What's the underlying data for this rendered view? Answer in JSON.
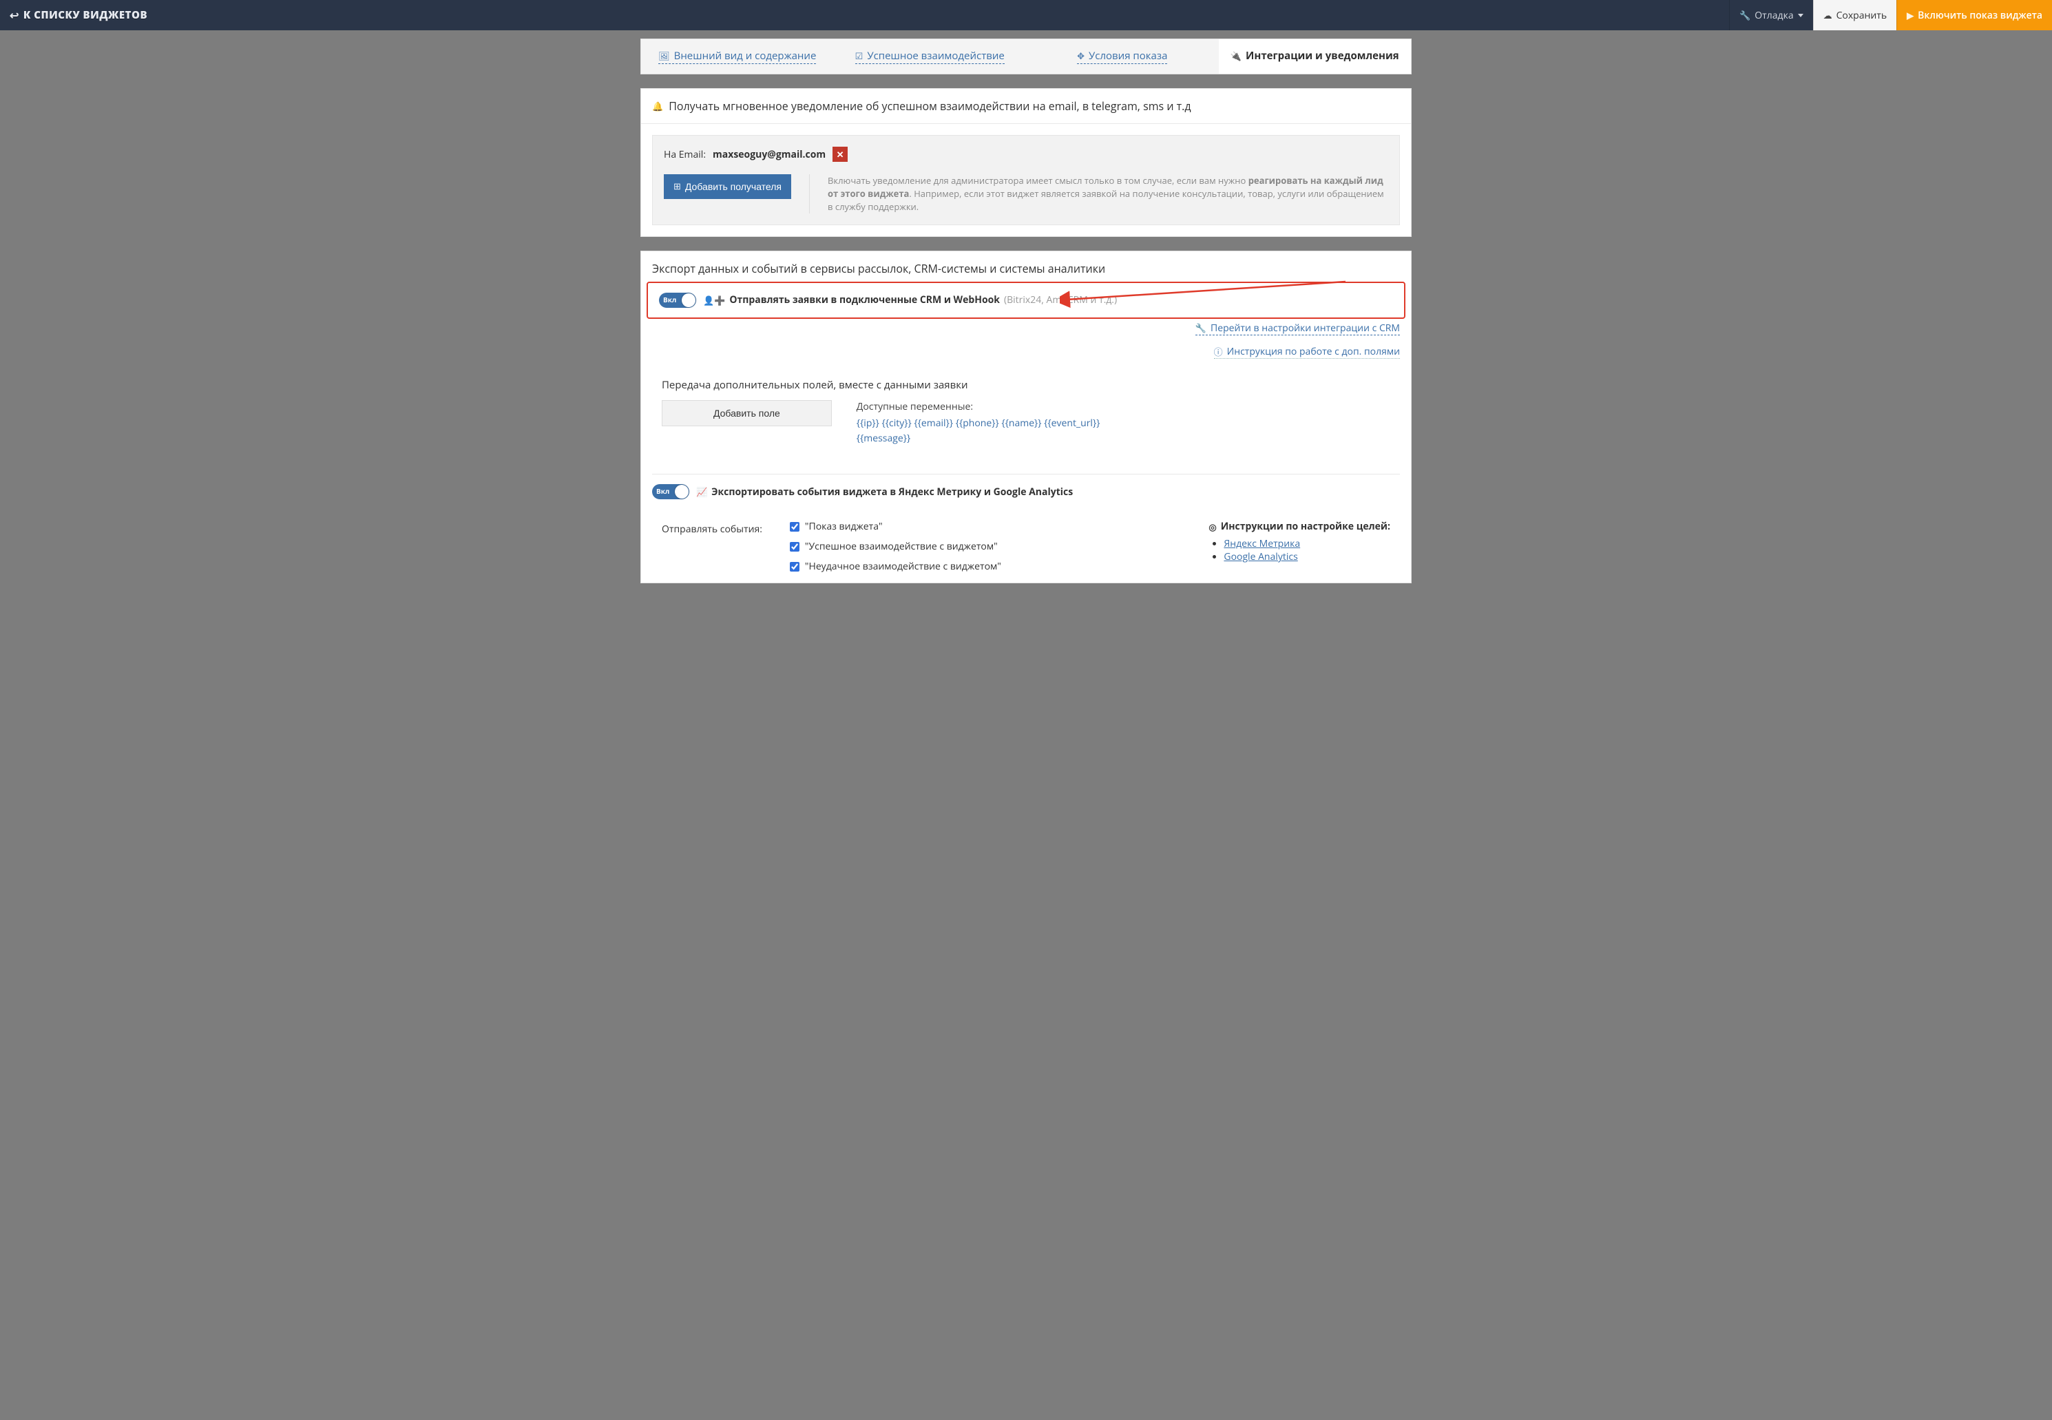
{
  "topbar": {
    "back_label": "К СПИСКУ ВИДЖЕТОВ",
    "debug_label": "Отладка",
    "save_label": "Сохранить",
    "enable_label": "Включить показ виджета"
  },
  "tabs": {
    "appearance": "Внешний вид и содержание",
    "success": "Успешное взаимодействие",
    "conditions": "Условия показа",
    "integrations": "Интеграции и уведомления"
  },
  "notify_card": {
    "title": "Получать мгновенное уведомление об успешном взаимодействии на email, в telegram, sms и т.д",
    "email_label": "На Email:",
    "email_value": "maxseoguy@gmail.com",
    "add_recipient": "Добавить получателя",
    "hint_prefix": "Включать уведомление для администратора имеет смысл только в том случае, если вам нужно ",
    "hint_strong": "реагировать на каждый лид от этого виджета",
    "hint_suffix": ". Например, если этот виджет является заявкой на получение консультации, товар, услуги или обращением в службу поддержки."
  },
  "export_card": {
    "title": "Экспорт данных и событий в сервисы рассылок, CRM-системы и системы аналитики"
  },
  "crm_toggle": {
    "on_label": "Вкл",
    "title": "Отправлять заявки в подключенные CRM и WebHook",
    "sub": "(Bitrix24, AmoCRM и т.д.)",
    "settings_link": "Перейти в настройки интеграции с CRM",
    "info_link": "Инструкция по работе с доп. полями",
    "extra_fields_title": "Передача дополнительных полей, вместе с данными заявки",
    "add_field": "Добавить поле",
    "available_label": "Доступные переменные:",
    "tokens": "{{ip}} {{city}} {{email}} {{phone}} {{name}} {{event_url}} {{message}}"
  },
  "analytics_toggle": {
    "on_label": "Вкл",
    "title": "Экспортировать события виджета в Яндекс Метрику и Google Analytics",
    "send_events_label": "Отправлять события:",
    "events": [
      "\"Показ виджета\"",
      "\"Успешное взаимодействие с виджетом\"",
      "\"Неудачное взаимодействие с виджетом\""
    ],
    "instructions_title": "Инструкции по настройке целей:",
    "links": {
      "metrika": "Яндекс Метрика",
      "ga": "Google Analytics"
    }
  }
}
